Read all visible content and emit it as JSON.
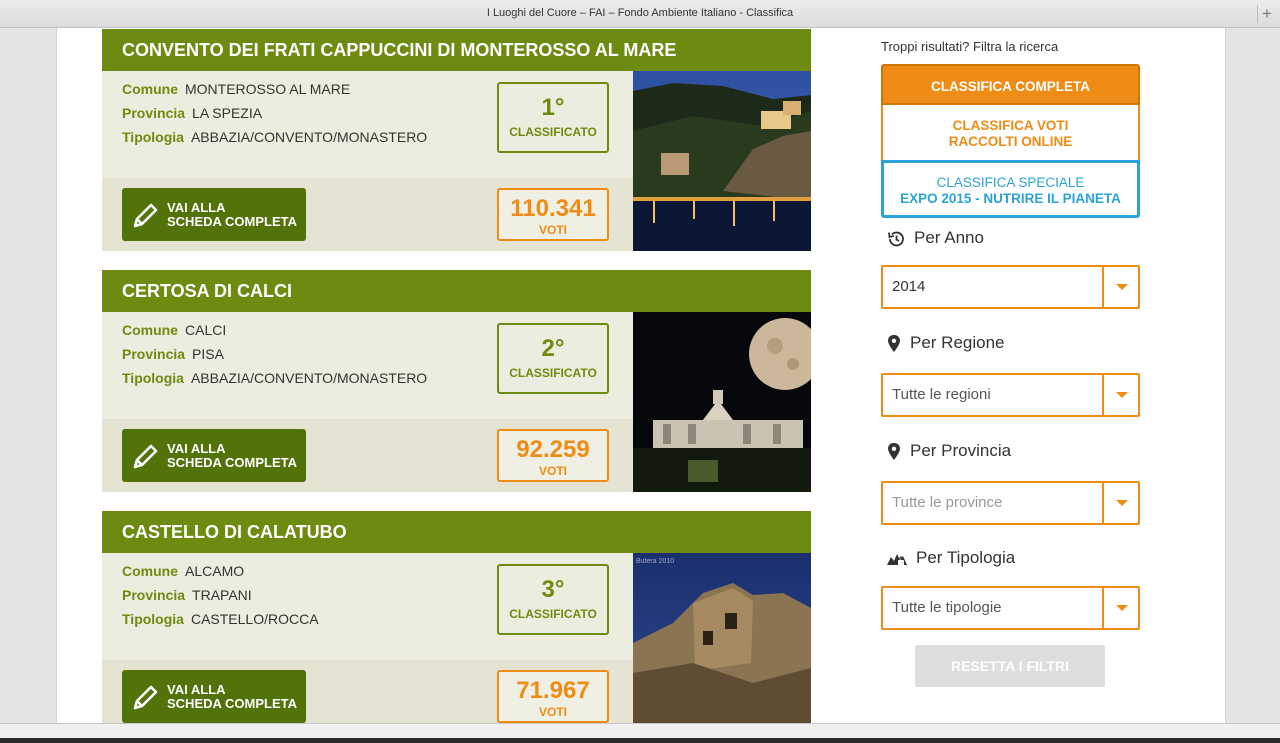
{
  "window": {
    "title": "I Luoghi del Cuore – FAI – Fondo Ambiente Italiano - Classifica"
  },
  "labels": {
    "comune": "Comune",
    "provincia": "Provincia",
    "tipologia": "Tipologia",
    "classificato": "CLASSIFICATO",
    "voti": "VOTI",
    "scheda_1": "VAI ALLA",
    "scheda_2": "SCHEDA COMPLETA"
  },
  "places": [
    {
      "name": "CONVENTO DEI FRATI CAPPUCCINI DI MONTEROSSO AL MARE",
      "comune": "MONTEROSSO AL MARE",
      "provincia": "LA SPEZIA",
      "tipologia": "ABBAZIA/CONVENTO/MONASTERO",
      "rank": "1°",
      "votes": "110.341"
    },
    {
      "name": "CERTOSA DI CALCI",
      "comune": "CALCI",
      "provincia": "PISA",
      "tipologia": "ABBAZIA/CONVENTO/MONASTERO",
      "rank": "2°",
      "votes": "92.259"
    },
    {
      "name": "CASTELLO DI CALATUBO",
      "comune": "ALCAMO",
      "provincia": "TRAPANI",
      "tipologia": "CASTELLO/ROCCA",
      "rank": "3°",
      "votes": "71.967",
      "photo_caption": "Butera 2010"
    }
  ],
  "sidebar": {
    "intro": "Troppi risultati? Filtra la ricerca",
    "tab_completa": "CLASSIFICA COMPLETA",
    "tab_online_1": "CLASSIFICA VOTI",
    "tab_online_2": "RACCOLTI ONLINE",
    "tab_expo_1": "CLASSIFICA SPECIALE",
    "tab_expo_2": "EXPO 2015 - NUTRIRE IL PIANETA",
    "anno_label": "Per Anno",
    "anno_value": "2014",
    "regione_label": "Per Regione",
    "regione_value": "Tutte le regioni",
    "provincia_label": "Per Provincia",
    "provincia_value": "Tutte le province",
    "tipologia_label": "Per Tipologia",
    "tipologia_value": "Tutte le tipologie",
    "reset": "RESETTA I FILTRI"
  },
  "colors": {
    "green": "#6d8a11",
    "dark_green": "#51730a",
    "orange": "#ee8c16",
    "blue": "#2aa3d9"
  }
}
